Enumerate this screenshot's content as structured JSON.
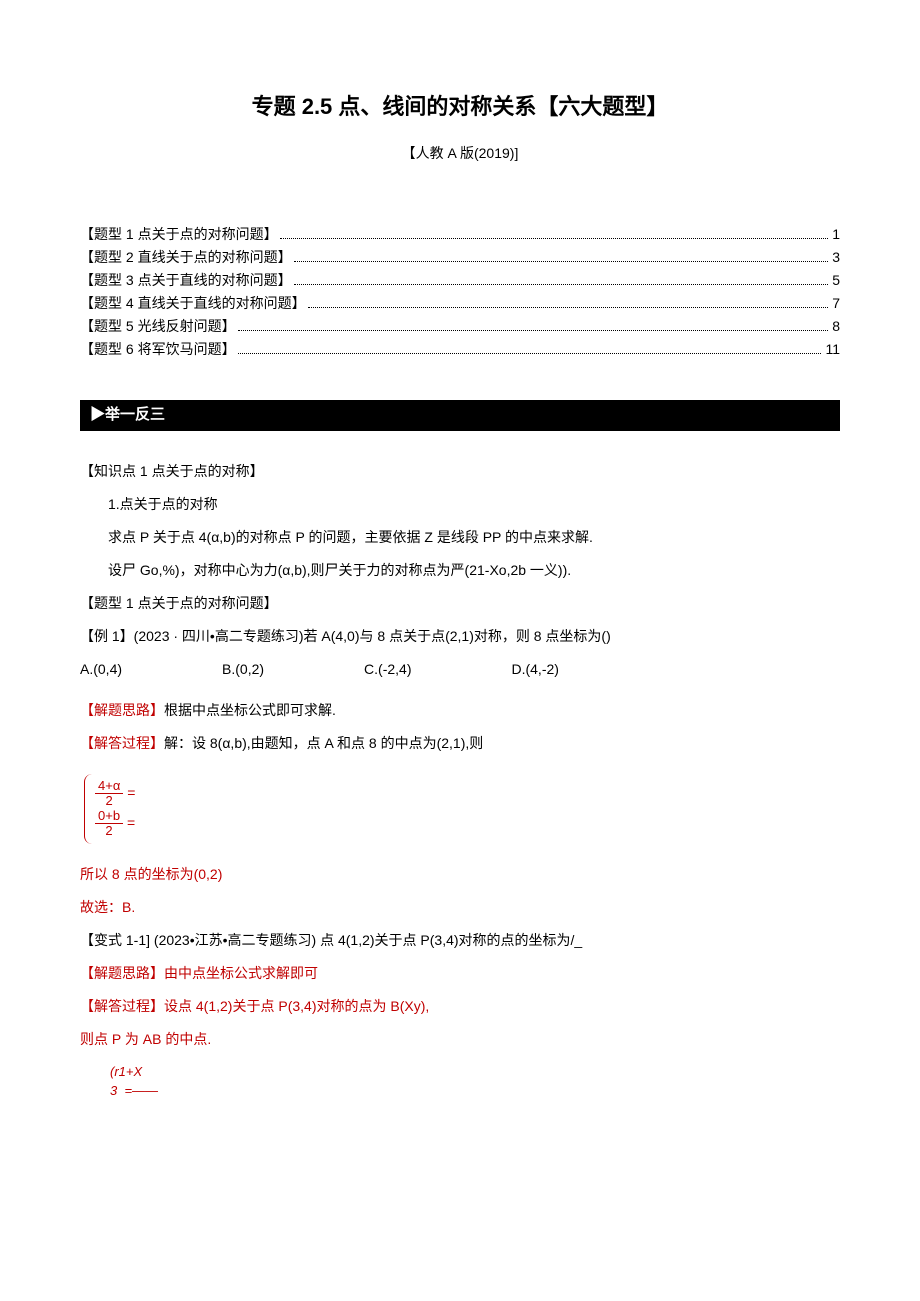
{
  "title": "专题 2.5 点、线间的对称关系【六大题型】",
  "subtitle": "【人教 A 版(2019)]",
  "toc": [
    {
      "label": "【题型 1 点关于点的对称问题】",
      "page": "1"
    },
    {
      "label": "【题型 2 直线关于点的对称问题】",
      "page": "3"
    },
    {
      "label": "【题型 3 点关于直线的对称问题】",
      "page": "5"
    },
    {
      "label": "【题型 4 直线关于直线的对称问题】",
      "page": "7"
    },
    {
      "label": "【题型 5 光线反射问题】",
      "page": "8"
    },
    {
      "label": "【题型 6 将军饮马问题】",
      "page": "11"
    }
  ],
  "section_bar": "▶举一反三",
  "kp_heading": "【知识点 1 点关于点的对称】",
  "kp_line1": "1.点关于点的对称",
  "kp_line2": "求点 P 关于点 4(α,b)的对称点 P 的问题，主要依据 Z 是线段 PP 的中点来求解.",
  "kp_line3": "设尸 Go,%)，对称中心为力(α,b),则尸关于力的对称点为严(21-Xo,2b 一义)).",
  "qtype_heading": "【题型 1 点关于点的对称问题】",
  "example1_stem": "【例 1】(2023 · 四川•高二专题练习)若 A(4,0)与 8 点关于点(2,1)对称，则 8 点坐标为()",
  "options": {
    "A": "A.(0,4)",
    "B": "B.(0,2)",
    "C": "C.(-2,4)",
    "D": "D.(4,-2)"
  },
  "sol_thought_label": "【解题思路】",
  "sol_thought_text": "根据中点坐标公式即可求解.",
  "sol_proc_label": "【解答过程】",
  "sol_proc_text": "解：设 8(α,b),由题知，点 A 和点 8 的中点为(2,1),则",
  "brace": {
    "top_num": "4+α",
    "top_den": "2",
    "bot_num": "0+b",
    "bot_den": "2",
    "eq": "="
  },
  "sol_result": "所以 8 点的坐标为(0,2)",
  "sol_choice": "故选：B.",
  "var1_stem": "【变式 1-1] (2023•江苏•高二专题练习) 点 4(1,2)关于点 P(3,4)对称的点的坐标为/_",
  "var1_thought": "由中点坐标公式求解即可",
  "var1_proc": "设点 4(1,2)关于点 P(3,4)对称的点为 B(Xy),",
  "var1_mid": "则点 P 为 AB 的中点.",
  "var1_formula": {
    "line1": "(r1+X",
    "line2": "3",
    "line3": "=——"
  }
}
